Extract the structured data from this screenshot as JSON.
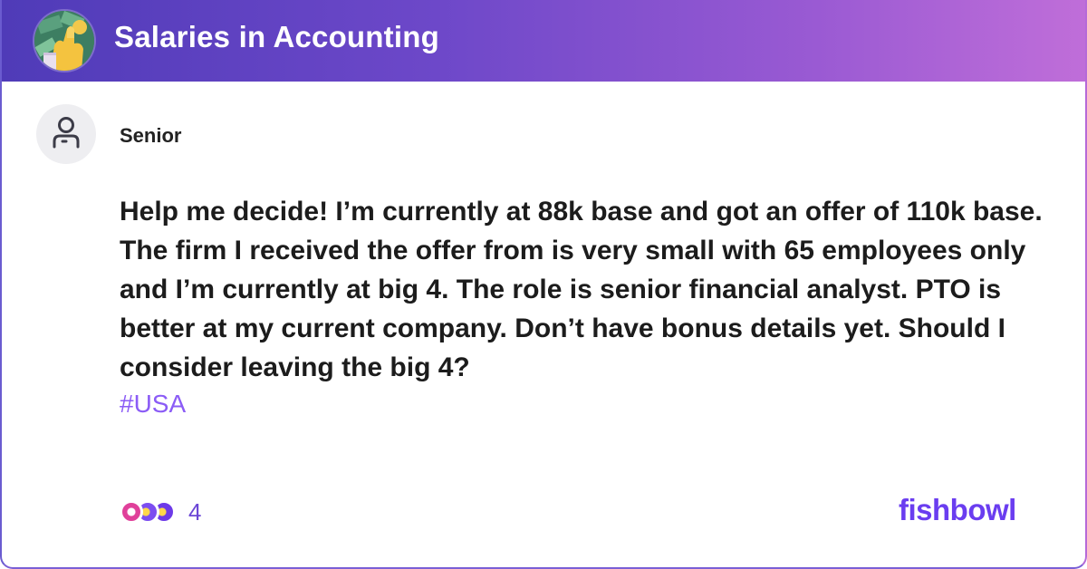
{
  "header": {
    "bowl_title": "Salaries in Accounting",
    "bowl_avatar_icon": "money-hand-icon",
    "gradient_colors": [
      "#4f3bb8",
      "#c06ed9"
    ]
  },
  "post": {
    "author": "Senior",
    "author_avatar_icon": "user-icon",
    "body": "Help me decide! I’m currently at 88k base and got an offer of 110k base. The firm I received the offer from is very small with 65 employees only and I’m currently at big 4. The role is senior financial analyst. PTO is better at my current company. Don’t have bonus details yet. Should I consider leaving the big 4?",
    "hashtag": "#USA",
    "hashtag_color": "#8b5cf6"
  },
  "footer": {
    "reaction_icons": [
      "heart-reaction-icon",
      "star-reaction-icon",
      "idea-reaction-icon"
    ],
    "reaction_count": "4",
    "brand": "fishbowl",
    "brand_color": "#6a3df0"
  }
}
